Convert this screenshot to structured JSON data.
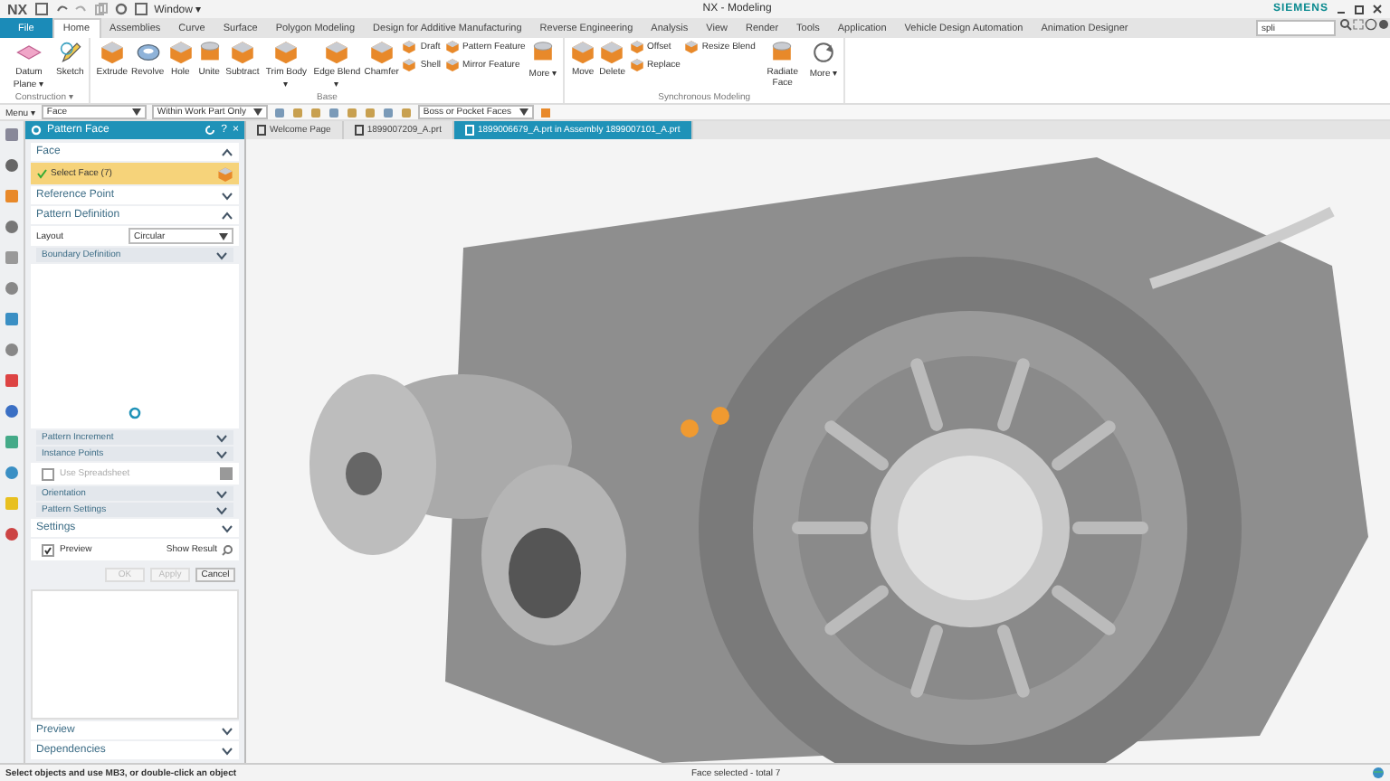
{
  "title_bar": {
    "logo": "NX",
    "window_menu": "Window ▾",
    "title": "NX - Modeling",
    "brand": "SIEMENS"
  },
  "menu_tabs": [
    {
      "label": "File",
      "selected": false,
      "kind": "file"
    },
    {
      "label": "Home",
      "selected": true,
      "kind": "tab"
    },
    {
      "label": "Assemblies",
      "selected": false,
      "kind": "tab"
    },
    {
      "label": "Curve",
      "selected": false,
      "kind": "tab"
    },
    {
      "label": "Surface",
      "selected": false,
      "kind": "tab"
    },
    {
      "label": "Polygon Modeling",
      "selected": false,
      "kind": "tab"
    },
    {
      "label": "Design for Additive Manufacturing",
      "selected": false,
      "kind": "tab"
    },
    {
      "label": "Reverse Engineering",
      "selected": false,
      "kind": "tab"
    },
    {
      "label": "Analysis",
      "selected": false,
      "kind": "tab"
    },
    {
      "label": "View",
      "selected": false,
      "kind": "tab"
    },
    {
      "label": "Render",
      "selected": false,
      "kind": "tab"
    },
    {
      "label": "Tools",
      "selected": false,
      "kind": "tab"
    },
    {
      "label": "Application",
      "selected": false,
      "kind": "tab"
    },
    {
      "label": "Vehicle Design Automation",
      "selected": false,
      "kind": "tab"
    },
    {
      "label": "Animation Designer",
      "selected": false,
      "kind": "tab"
    }
  ],
  "command_search": {
    "value": "spli"
  },
  "ribbon": {
    "groups": [
      {
        "label": "Construction ▾",
        "buttons": [
          {
            "label": "Datum Plane ▾",
            "kind": "large"
          },
          {
            "label": "Sketch",
            "kind": "large"
          }
        ]
      },
      {
        "label": "Base",
        "buttons": [
          {
            "label": "Extrude",
            "kind": "large"
          },
          {
            "label": "Revolve",
            "kind": "large"
          },
          {
            "label": "Hole",
            "kind": "large"
          },
          {
            "label": "Unite",
            "kind": "large"
          },
          {
            "label": "Subtract",
            "kind": "large"
          },
          {
            "label": "Trim Body ▾",
            "kind": "large"
          },
          {
            "label": "Edge Blend ▾",
            "kind": "large"
          },
          {
            "label": "Chamfer",
            "kind": "large"
          },
          {
            "label": "Draft",
            "kind": "small"
          },
          {
            "label": "Shell",
            "kind": "small"
          },
          {
            "label": "Pattern Feature",
            "kind": "small"
          },
          {
            "label": "Mirror Feature",
            "kind": "small"
          },
          {
            "label": "More ▾",
            "kind": "large"
          }
        ]
      },
      {
        "label": "Synchronous Modeling",
        "buttons": [
          {
            "label": "Move",
            "kind": "large"
          },
          {
            "label": "Delete",
            "kind": "large"
          },
          {
            "label": "Offset",
            "kind": "small"
          },
          {
            "label": "Replace",
            "kind": "small"
          },
          {
            "label": "Resize Blend",
            "kind": "small"
          },
          {
            "label": "Radiate Face",
            "kind": "large"
          },
          {
            "label": "More ▾",
            "kind": "large"
          }
        ]
      }
    ]
  },
  "selection_bar": {
    "menu": "Menu ▾",
    "type_filter": "Face",
    "scope_filter": "Within Work Part Only",
    "rule_filter": "Boss or Pocket Faces"
  },
  "dialog": {
    "title": "Pattern Face",
    "help": "?",
    "close": "×",
    "items": [
      {
        "kind": "section",
        "label": "Face",
        "expanded": true
      },
      {
        "kind": "selection",
        "label": "Select Face (7)"
      },
      {
        "kind": "section",
        "label": "Reference Point",
        "expanded": false
      },
      {
        "kind": "section",
        "label": "Pattern Definition",
        "expanded": true
      },
      {
        "kind": "dropdown",
        "label": "Layout",
        "value": "Circular"
      },
      {
        "kind": "subsection",
        "label": "Boundary Definition",
        "expanded": false
      },
      {
        "kind": "busy"
      },
      {
        "kind": "subsection",
        "label": "Pattern Increment",
        "expanded": false
      },
      {
        "kind": "subsection",
        "label": "Instance Points",
        "expanded": false
      },
      {
        "kind": "checkbox",
        "label": "Use Spreadsheet",
        "checked": false,
        "disabled": true
      },
      {
        "kind": "subsection",
        "label": "Orientation",
        "expanded": false
      },
      {
        "kind": "subsection",
        "label": "Pattern Settings",
        "expanded": false
      },
      {
        "kind": "section",
        "label": "Settings",
        "expanded": false
      },
      {
        "kind": "preview",
        "label": "Preview",
        "checked": true,
        "result_label": "Show Result"
      },
      {
        "kind": "buttons",
        "buttons": [
          {
            "label": "OK",
            "disabled": true
          },
          {
            "label": "Apply",
            "disabled": true
          },
          {
            "label": "Cancel",
            "disabled": false
          }
        ]
      },
      {
        "kind": "list"
      },
      {
        "kind": "section",
        "label": "Preview",
        "expanded": false
      },
      {
        "kind": "section",
        "label": "Dependencies",
        "expanded": false
      }
    ]
  },
  "document_tabs": [
    {
      "label": "Welcome Page",
      "selected": false
    },
    {
      "label": "1899007209_A.prt",
      "selected": false
    },
    {
      "label": "1899006679_A.prt in Assembly 1899007101_A.prt",
      "selected": true
    }
  ],
  "status_bar": {
    "prompt": "Select objects and use MB3, or double-click an object",
    "message": "Face selected - total 7"
  }
}
